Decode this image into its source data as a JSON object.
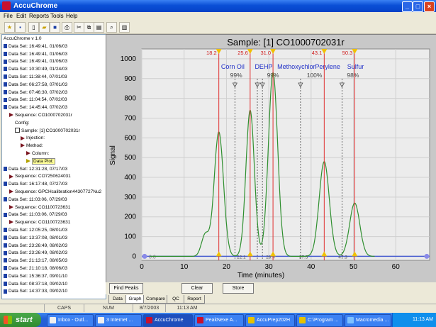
{
  "window": {
    "title": "AccuChrome"
  },
  "menu": [
    "File",
    "Edit",
    "Reports",
    "Tools",
    "Help"
  ],
  "toolbar": [
    "open-icon",
    "save-icon",
    "new-icon",
    "folder-icon",
    "disk-icon",
    "print-icon",
    "cut-icon",
    "copy-icon",
    "paste-icon",
    "zoom-icon",
    "chart-icon"
  ],
  "tree": [
    {
      "kind": "root",
      "indent": 0,
      "text": "AccuChrome v 1.0"
    },
    {
      "kind": "ds",
      "indent": 0,
      "text": "Data Set: 16:49:41, 01/06/03"
    },
    {
      "kind": "ds",
      "indent": 0,
      "text": "Data Set: 16:49:41, 01/06/03"
    },
    {
      "kind": "ds",
      "indent": 0,
      "text": "Data Set: 16:49:41, 01/06/03"
    },
    {
      "kind": "ds",
      "indent": 0,
      "text": "Data Set: 10:30:49, 01/24/03"
    },
    {
      "kind": "ds",
      "indent": 0,
      "text": "Data Set: 11:38:44, 07/01/03"
    },
    {
      "kind": "ds",
      "indent": 0,
      "text": "Data Set: 06:27:58, 07/01/03"
    },
    {
      "kind": "ds",
      "indent": 0,
      "text": "Data Set: 07:46:30, 07/02/03"
    },
    {
      "kind": "ds",
      "indent": 0,
      "text": "Data Set: 11:04:54, 07/02/03"
    },
    {
      "kind": "ds",
      "indent": 0,
      "text": "Data Set: 14:45:44, 07/02/03"
    },
    {
      "kind": "seq",
      "indent": 1,
      "text": "Sequence:  CO1000702031r"
    },
    {
      "kind": "leaf",
      "indent": 2,
      "text": "Config:"
    },
    {
      "kind": "sample",
      "indent": 2,
      "text": "Sample:  [1]  CO1000702031r"
    },
    {
      "kind": "arrowleaf",
      "indent": 3,
      "text": "Injection:"
    },
    {
      "kind": "arrowleaf",
      "indent": 3,
      "text": "Method:"
    },
    {
      "kind": "arrowleaf",
      "indent": 4,
      "text": "Column:"
    },
    {
      "kind": "plot",
      "indent": 4,
      "text": "Data Plot:"
    },
    {
      "kind": "ds",
      "indent": 0,
      "text": "Data Set: 12:31:28, 07/17/03"
    },
    {
      "kind": "seq",
      "indent": 1,
      "text": "Sequence:  CO7250624031"
    },
    {
      "kind": "ds",
      "indent": 0,
      "text": "Data Set: 16:17:48, 07/27/03"
    },
    {
      "kind": "seq",
      "indent": 1,
      "text": "Sequence:  GPCHcalibration44307727Nu2"
    },
    {
      "kind": "ds",
      "indent": 0,
      "text": "Data Set: 11:03:06, 07/29/03"
    },
    {
      "kind": "seq",
      "indent": 1,
      "text": "Sequence:  CO1100723631"
    },
    {
      "kind": "ds",
      "indent": 0,
      "text": "Data Set: 11:03:06, 07/29/03"
    },
    {
      "kind": "seq",
      "indent": 1,
      "text": "Sequence:  CO1100723631"
    },
    {
      "kind": "ds",
      "indent": 0,
      "text": "Data Set: 12:05:25, 08/01/03"
    },
    {
      "kind": "ds",
      "indent": 0,
      "text": "Data Set: 13:37:08, 08/01/03"
    },
    {
      "kind": "ds",
      "indent": 0,
      "text": "Data Set: 23:26:49, 08/02/03"
    },
    {
      "kind": "ds",
      "indent": 0,
      "text": "Data Set: 23:26:49, 08/02/03"
    },
    {
      "kind": "ds",
      "indent": 0,
      "text": "Data Set: 21:13:17, 08/05/03"
    },
    {
      "kind": "ds",
      "indent": 0,
      "text": "Data Set: 21:10:18, 08/06/03"
    },
    {
      "kind": "ds",
      "indent": 0,
      "text": "Data Set: 15:36:37, 09/01/10"
    },
    {
      "kind": "ds",
      "indent": 0,
      "text": "Data Set: 08:37:18, 09/02/10"
    },
    {
      "kind": "ds",
      "indent": 0,
      "text": "Data Set: 14:37:33, 09/02/10"
    }
  ],
  "chart_data": {
    "type": "line",
    "title": "Sample:  [1]  CO1000702031r",
    "xlabel": "Time (minutes)",
    "ylabel": "Signal",
    "xlim": [
      0,
      68
    ],
    "ylim": [
      -20,
      1050
    ],
    "xticks": [
      0,
      10,
      20,
      30,
      40,
      50,
      60
    ],
    "yticks": [
      0,
      100,
      200,
      300,
      400,
      500,
      600,
      700,
      800,
      900,
      1000
    ],
    "grid": true,
    "series": [
      {
        "peaks": [
          {
            "rt": 15.0,
            "height": 110,
            "width": 0.9
          },
          {
            "rt": 18.2,
            "height": 630,
            "width": 1.1
          },
          {
            "rt": 25.6,
            "height": 740,
            "width": 1.0
          },
          {
            "rt": 31.0,
            "height": 930,
            "width": 1.1
          },
          {
            "rt": 43.1,
            "height": 480,
            "width": 1.2
          },
          {
            "rt": 50.3,
            "height": 270,
            "width": 1.2
          }
        ]
      }
    ],
    "peak_labels": [
      {
        "rt": 18.2,
        "label": "18.2"
      },
      {
        "rt": 25.6,
        "label": "25.6"
      },
      {
        "rt": 31.0,
        "label": "31.0"
      },
      {
        "rt": 43.1,
        "label": "43.1"
      },
      {
        "rt": 50.3,
        "label": "50.3"
      }
    ],
    "fraction_names": [
      {
        "x": 21.5,
        "name": "Corn Oil"
      },
      {
        "x": 28.8,
        "name": "DEHP"
      },
      {
        "x": 36.5,
        "name": "Methoxychlor"
      },
      {
        "x": 43.9,
        "name": "Perylene"
      },
      {
        "x": 50.5,
        "name": "Sulfur"
      }
    ],
    "percents": [
      {
        "x": 22.3,
        "label": "99%"
      },
      {
        "x": 31.0,
        "label": "99%"
      },
      {
        "x": 40.8,
        "label": "100%"
      },
      {
        "x": 49.9,
        "label": "98%"
      }
    ],
    "collection_bounds": [
      22.0,
      27.3,
      28.5,
      37.5,
      47.3
    ],
    "bottom_labels": [
      {
        "x": 23.5,
        "label": "22.1"
      },
      {
        "x": 30.4,
        "label": "28.4"
      },
      {
        "x": 38.2,
        "label": "37.5"
      },
      {
        "x": 47.5,
        "label": "47.3"
      }
    ],
    "start_label": "0.0"
  },
  "buttons": {
    "find_peaks": "Find Peaks",
    "clear": "Clear",
    "store": "Store"
  },
  "tabs": [
    "Data",
    "Graph",
    "Compare",
    "QC",
    "Report"
  ],
  "status": {
    "caps": "CAPS",
    "num": "NUM",
    "date": "8/7/2003",
    "time": "11:13 AM"
  },
  "taskbar": {
    "start": "start",
    "tasks": [
      "Inbox - Outl...",
      "3 Internet ...",
      "AccuChrome",
      "PeakNexe A...",
      "AccuPrep202H",
      "C:\\Program ...",
      "Macromedia ..."
    ],
    "clock": "11:13 AM"
  }
}
